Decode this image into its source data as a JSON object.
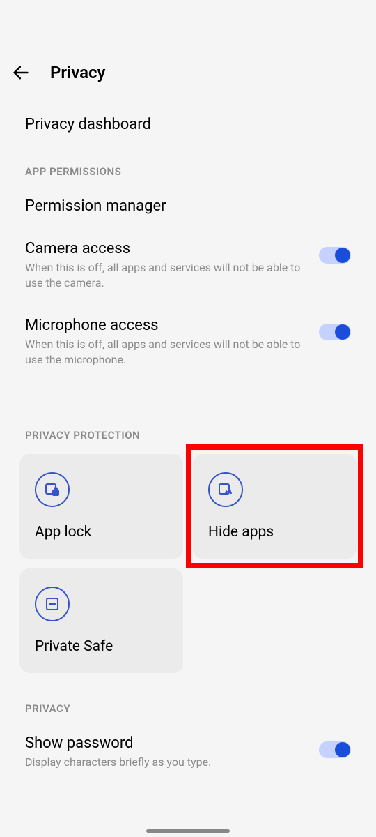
{
  "header": {
    "title": "Privacy"
  },
  "items": {
    "dashboard": "Privacy dashboard",
    "permission_manager": "Permission manager",
    "camera_title": "Camera access",
    "camera_subtitle": "When this is off, all apps and services will not be able to use the camera.",
    "mic_title": "Microphone access",
    "mic_subtitle": "When this is off, all apps and services will not be able to use the microphone.",
    "show_password_title": "Show password",
    "show_password_subtitle": "Display characters briefly as you type."
  },
  "sections": {
    "app_permissions": "APP PERMISSIONS",
    "privacy_protection": "PRIVACY PROTECTION",
    "privacy": "PRIVACY"
  },
  "cards": {
    "app_lock": "App lock",
    "hide_apps": "Hide apps",
    "private_safe": "Private Safe"
  }
}
